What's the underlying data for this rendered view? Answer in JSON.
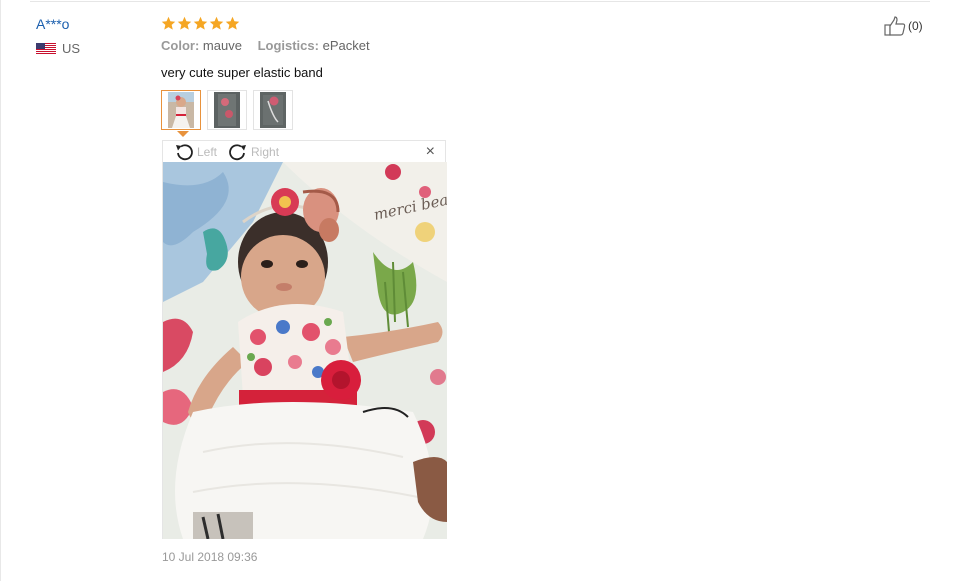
{
  "buyer": {
    "name": "A***o",
    "country": "US",
    "flag_icon": "us-flag-icon"
  },
  "review": {
    "rating": 5,
    "rating_max": 5,
    "star_color": "#f5a623",
    "color_label": "Color:",
    "color_value": "mauve",
    "logistics_label": "Logistics:",
    "logistics_value": "ePacket",
    "text": "very cute super elastic band",
    "date": "10 Jul 2018 09:36"
  },
  "helpful": {
    "icon": "thumbs-up-icon",
    "count": "(0)"
  },
  "thumbnails": [
    {
      "name": "review-photo-1",
      "selected": true
    },
    {
      "name": "review-photo-2",
      "selected": false
    },
    {
      "name": "review-photo-3",
      "selected": false
    }
  ],
  "viewer": {
    "rotate_left": "Left",
    "rotate_right": "Right",
    "close": "×",
    "accent": "#e8923c"
  }
}
